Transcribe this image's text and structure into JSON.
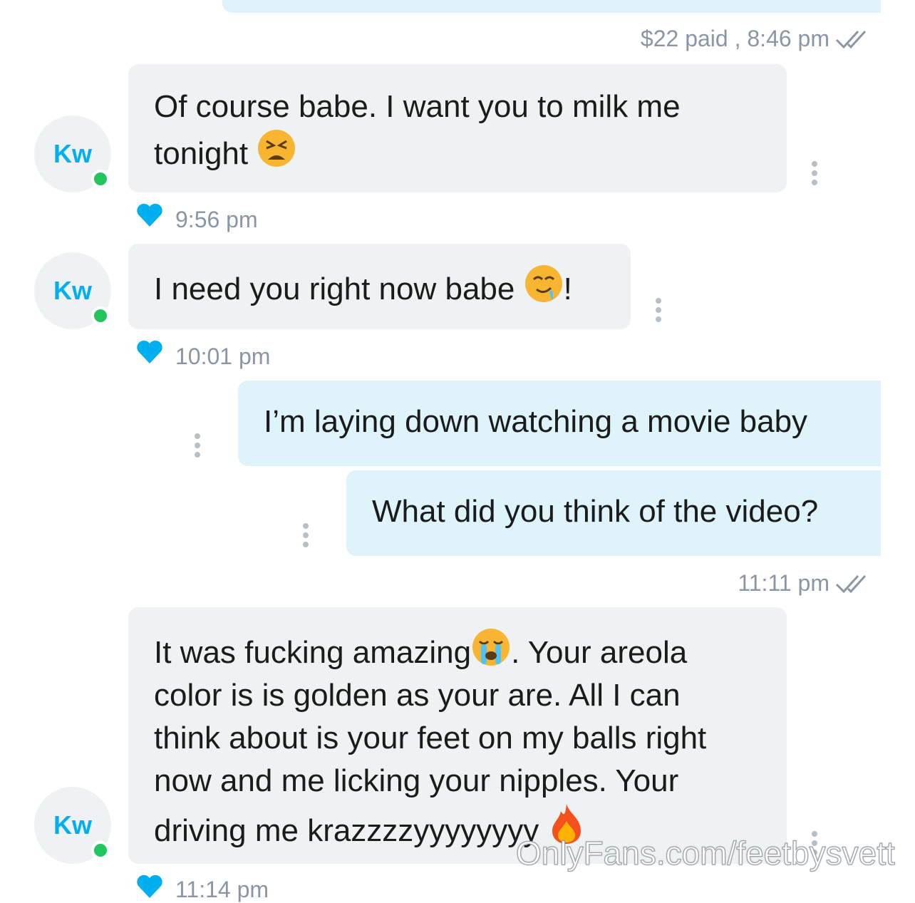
{
  "colors": {
    "accent": "#00aff0",
    "incoming_bg": "#eff2f3",
    "outgoing_bg": "#def4fa",
    "meta": "#8a96a3",
    "online": "#22c55e"
  },
  "header_meta": {
    "text": "$22 paid , 8:46 pm"
  },
  "messages": [
    {
      "sender": "Kw",
      "text_a": "Of course babe. I want you to milk me",
      "text_b": "tonight ",
      "emoji": "tired-face-emoji",
      "time": "9:56 pm",
      "liked": true
    },
    {
      "sender": "Kw",
      "text_a": "I need you right now babe ",
      "emoji": "drooling-face-emoji",
      "text_b": "!",
      "time": "10:01 pm",
      "liked": true
    },
    {
      "sender": "me",
      "text": "I’m laying down watching a movie baby"
    },
    {
      "sender": "me",
      "text": "What did you think of the video?",
      "time": "11:11 pm",
      "read": true
    },
    {
      "sender": "Kw",
      "text_a": "It was fucking amazing",
      "emoji": "crying-face-emoji",
      "text_b": ". Your areola",
      "text_c": "color is is golden as your are. All I can",
      "text_d": "think about is your feet on my balls right",
      "text_e": "now and me licking your nipples. Your",
      "text_f": "driving me krazzzzyyyyyyyy ",
      "emoji2": "fire-emoji",
      "time": "11:14 pm",
      "liked": true
    }
  ],
  "watermark": "OnlyFans.com/feetbysvett"
}
